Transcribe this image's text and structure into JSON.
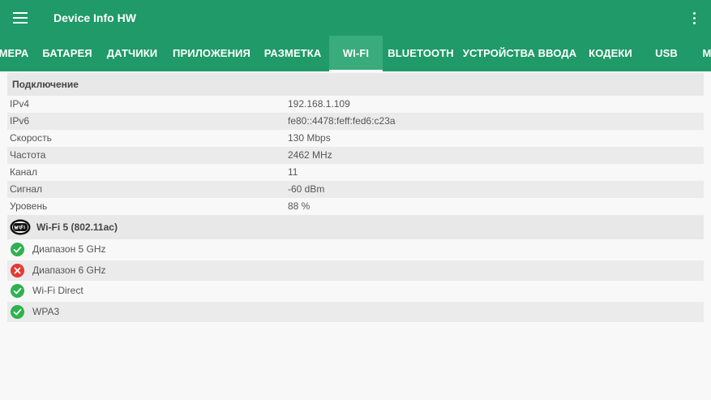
{
  "appbar": {
    "title": "Device Info HW",
    "bg": "#1f9a68"
  },
  "tabs": [
    {
      "label": "МЕРА"
    },
    {
      "label": "БАТАРЕЯ"
    },
    {
      "label": "ДАТЧИКИ"
    },
    {
      "label": "ПРИЛОЖЕНИЯ"
    },
    {
      "label": "РАЗМЕТКА"
    },
    {
      "label": "WI-FI",
      "active": true
    },
    {
      "label": "BLUETOOTH"
    },
    {
      "label": "УСТРОЙСТВА ВВОДА"
    },
    {
      "label": "КОДЕКИ"
    },
    {
      "label": "USB"
    },
    {
      "label": "М"
    }
  ],
  "connection": {
    "title": "Подключение",
    "rows": [
      {
        "label": "IPv4",
        "value": "192.168.1.109"
      },
      {
        "label": "IPv6",
        "value": "fe80::4478:feff:fed6:c23a"
      },
      {
        "label": "Скорость",
        "value": "130 Mbps"
      },
      {
        "label": "Частота",
        "value": "2462 MHz"
      },
      {
        "label": "Канал",
        "value": "11"
      },
      {
        "label": "Сигнал",
        "value": "-60 dBm"
      },
      {
        "label": "Уровень",
        "value": "88 %"
      }
    ]
  },
  "wifi": {
    "title": "Wi-Fi 5 (802.11ac)",
    "badge_icon": "wifi-certified-icon",
    "features": [
      {
        "label": "Диапазон 5 GHz",
        "supported": true,
        "icon": "check-circle-icon"
      },
      {
        "label": "Диапазон 6 GHz",
        "supported": false,
        "icon": "cross-circle-icon"
      },
      {
        "label": "Wi-Fi Direct",
        "supported": true,
        "icon": "check-circle-icon"
      },
      {
        "label": "WPA3",
        "supported": true,
        "icon": "check-circle-icon"
      }
    ]
  },
  "colors": {
    "ok": "#2eb24f",
    "fail": "#e53935",
    "accent": "#1f9a68"
  }
}
